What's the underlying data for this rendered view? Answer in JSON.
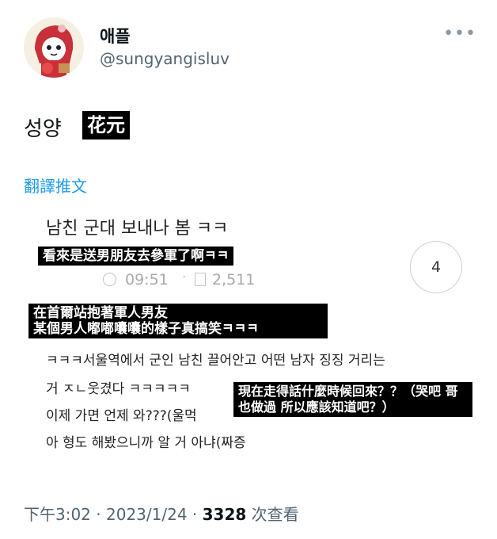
{
  "author": {
    "display_name": "애플",
    "handle": "@sungyangisluv",
    "avatar_icon": "cartoon-avatar-icon"
  },
  "more_icon": "more-dots-icon",
  "tweet": {
    "text": "성양",
    "boxed_text": "花元",
    "translate_label": "翻譯推文"
  },
  "embedded": {
    "post_title": "남친 군대 보내나 봄 ㅋㅋ",
    "caption1": "看來是送男朋友去參軍了啊ㅋㅋ",
    "time": "09:51",
    "views": "2,511",
    "comments": "4",
    "caption2_line1": "在首爾站抱著軍人男友",
    "caption2_line2": "某個男人嘟嘟囔囔的樣子真搞笑ㅋㅋㅋ",
    "body_line1": "ㅋㅋㅋ서울역에서 군인 남친 끌어안고 어떤 남자 징징 거리는",
    "body_line2": "거 ㅈㄴ웃겼다 ㅋㅋㅋㅋㅋ",
    "body_line3": "이제 가면 언제 와???(울먹",
    "body_line4": "아 형도 해봤으니까 알 거 아냐(짜증",
    "caption3": "現在走得話什麼時候回來？？（哭吧 哥也做過 所以應該知道吧？）"
  },
  "footer": {
    "time": "下午3:02",
    "sep1": " · ",
    "date": "2023/1/24",
    "sep2": " · ",
    "views": "3328",
    "views_label": " 次查看"
  },
  "colors": {
    "link": "#1d9bf0",
    "secondary_text": "#536471",
    "caption_bg": "#000000"
  }
}
